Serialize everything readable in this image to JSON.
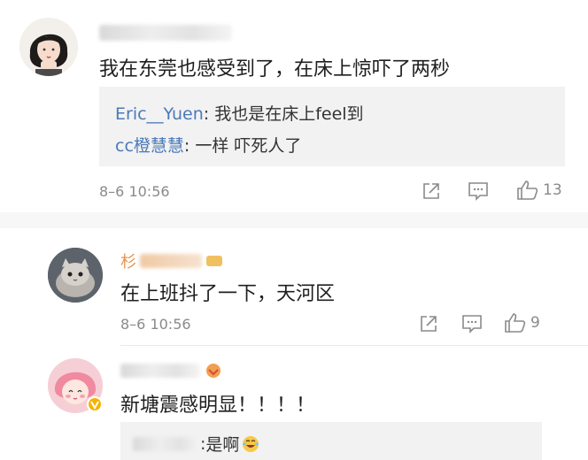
{
  "comments": [
    {
      "user_name": "",
      "text": "我在东莞也感受到了，在床上惊吓了两秒",
      "replies": [
        {
          "user": "Eric__Yuen",
          "sep": ": ",
          "text": "我也是在床上feel到"
        },
        {
          "user": "cc橙慧慧",
          "sep": ": ",
          "text": "一样 吓死人了"
        }
      ],
      "time": "8–6 10:56",
      "like_count": "13"
    },
    {
      "user_name": "杉",
      "text": "在上班抖了一下，天河区",
      "time": "8–6 10:56",
      "like_count": "9"
    },
    {
      "user_name": "",
      "text": "新塘震感明显！！！！",
      "replies": [
        {
          "user": "",
          "sep": ": ",
          "text": "是啊"
        }
      ]
    }
  ],
  "colors": {
    "reply_user": "#4b7ab8",
    "reply_bg": "#f2f2f2",
    "meta_gray": "#8a8a8a",
    "name_orange": "#e8924a",
    "badge_yellow": "#f5b400"
  },
  "icons": [
    "share-icon",
    "comment-icon",
    "like-icon",
    "vip-badge-icon",
    "laugh-emoji-icon"
  ]
}
